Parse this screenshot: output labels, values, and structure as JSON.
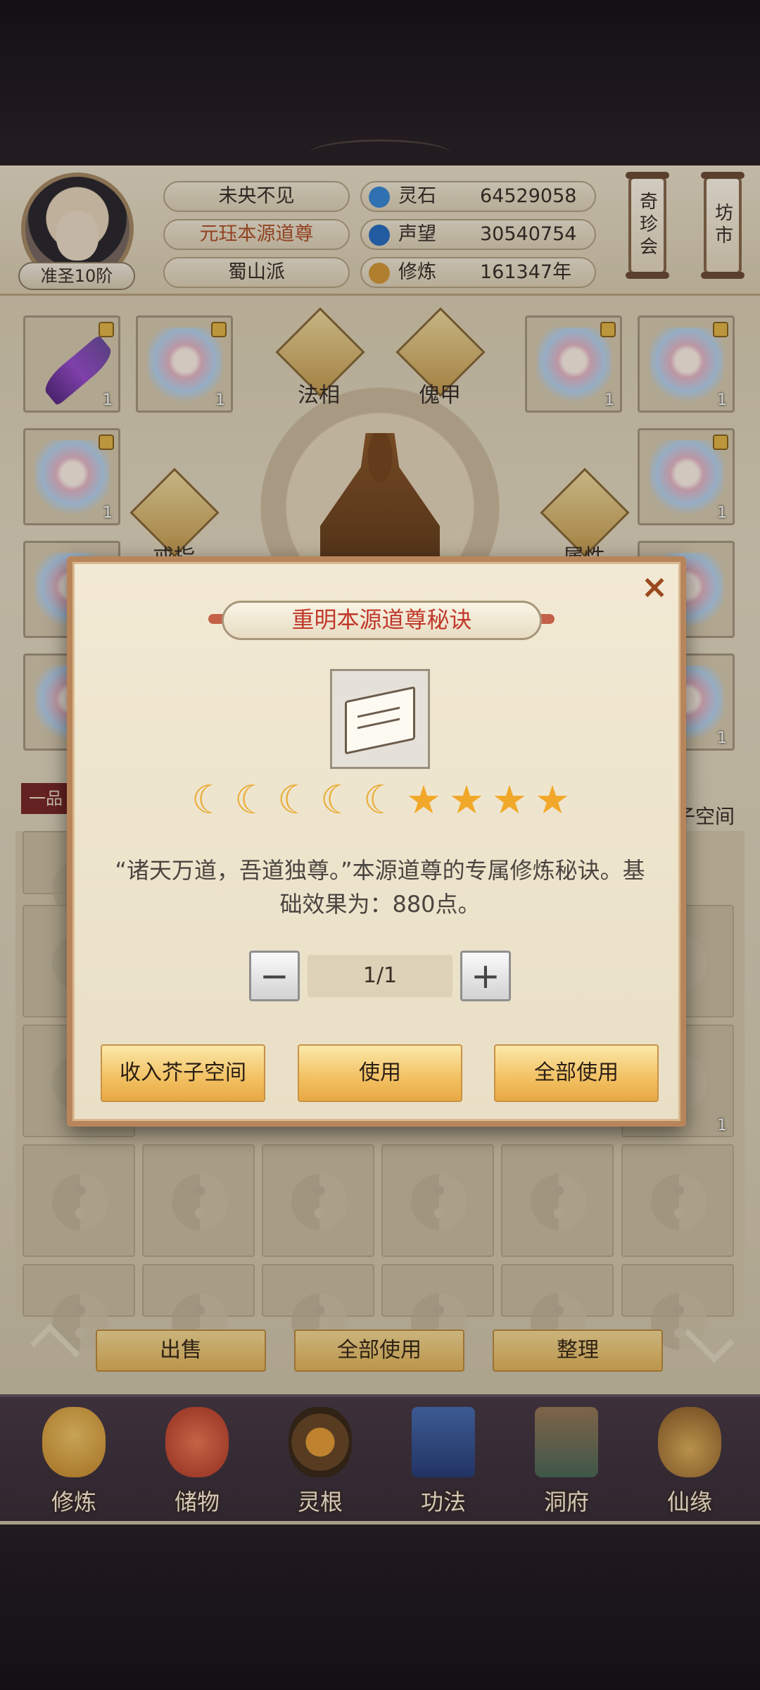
{
  "header": {
    "rank_badge": "准圣10阶",
    "name": "未央不见",
    "title": "元珏本源道尊",
    "sect": "蜀山派",
    "resources": [
      {
        "label": "灵石",
        "value": "64529058",
        "icon": "spirit-stone-icon",
        "color": "#3a8ad8"
      },
      {
        "label": "声望",
        "value": "30540754",
        "icon": "reputation-icon",
        "color": "#2b6fc4"
      },
      {
        "label": "修炼",
        "value": "161347年",
        "icon": "meditation-icon",
        "color": "#d69a3a"
      }
    ],
    "side_buttons": [
      "奇珍会",
      "坊市"
    ]
  },
  "equipment": {
    "diamond_labels": [
      "法相",
      "傀甲",
      "戒指",
      "属性"
    ],
    "slot_counts": [
      "1",
      "1",
      "1",
      "1",
      "1",
      "1",
      "1",
      "1"
    ],
    "side_label_left": "一品",
    "side_label_right": "子空间"
  },
  "inventory": {
    "visible_count": "1"
  },
  "bottom_actions": [
    "出售",
    "全部使用",
    "整理"
  ],
  "nav": [
    {
      "label": "修炼",
      "icon": "meditating-monk-icon"
    },
    {
      "label": "储物",
      "icon": "treasure-bag-icon"
    },
    {
      "label": "灵根",
      "icon": "spirit-root-icon"
    },
    {
      "label": "功法",
      "icon": "scroll-book-icon"
    },
    {
      "label": "洞府",
      "icon": "cave-mansion-icon"
    },
    {
      "label": "仙缘",
      "icon": "gourd-icon"
    }
  ],
  "modal": {
    "title": "重明本源道尊秘诀",
    "item_icon": "book-icon",
    "rating": {
      "moons": 5,
      "stars": 4
    },
    "description": "“诸天万道，吾道独尊。”本源道尊的专属修炼秘诀。基础效果为：880点。",
    "quantity": "1/1",
    "buttons": [
      "收入芥子空间",
      "使用",
      "全部使用"
    ],
    "close": "×"
  }
}
